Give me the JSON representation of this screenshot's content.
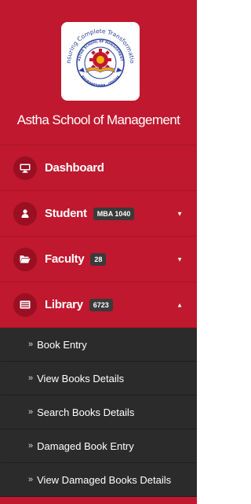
{
  "brand": {
    "name": "Astha School of Management",
    "logo_text_top": "Ensuring Complete Transformation",
    "logo_text_inner": "ASTHA SCHOOL OF MANAGEMENT",
    "logo_text_bottom": "BHUBANESWAR · ODISHA"
  },
  "nav": {
    "dashboard": {
      "label": "Dashboard",
      "icon": "desktop-icon"
    },
    "student": {
      "label": "Student",
      "badge": "MBA 1040",
      "icon": "user-icon",
      "caret": "chevron-down-icon"
    },
    "faculty": {
      "label": "Faculty",
      "badge": "28",
      "icon": "folder-icon",
      "caret": "chevron-down-icon"
    },
    "library": {
      "label": "Library",
      "badge": "6723",
      "icon": "list-icon",
      "caret": "chevron-up-icon"
    }
  },
  "submenu": {
    "items": [
      {
        "label": "Book Entry"
      },
      {
        "label": "View Books Details"
      },
      {
        "label": "Search Books Details"
      },
      {
        "label": "Damaged Book Entry"
      },
      {
        "label": "View Damaged Books Details"
      }
    ],
    "chevron": "»"
  },
  "colors": {
    "sidebar_bg": "#c0182e",
    "icon_circle": "#9a0f22",
    "submenu_bg": "#2b2b2b",
    "badge_bg": "#3a3a3a"
  }
}
